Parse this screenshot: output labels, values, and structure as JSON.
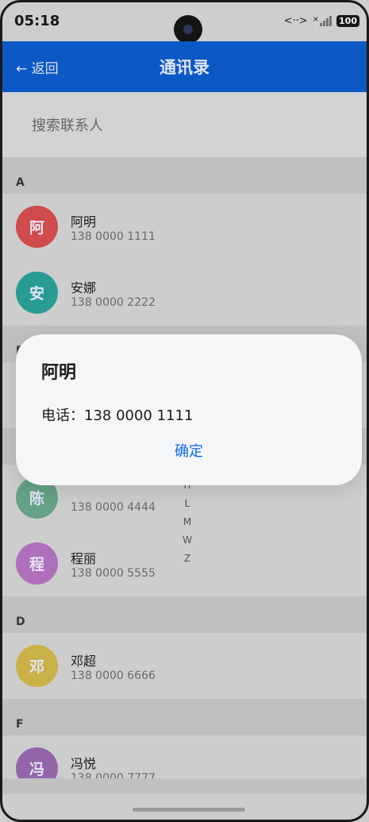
{
  "status_bar": {
    "time": "05:18",
    "network": "<··>",
    "signal_label": "×",
    "battery": "100"
  },
  "app_bar": {
    "back_label": "← 返回",
    "title": "通讯录"
  },
  "search": {
    "placeholder": "搜索联系人"
  },
  "sections": [
    {
      "letter": "A",
      "contacts": [
        {
          "initial": "阿",
          "name": "阿明",
          "phone": "138 0000 1111",
          "color": "#d94f4f"
        },
        {
          "initial": "安",
          "name": "安娜",
          "phone": "138 0000 2222",
          "color": "#2aa39a"
        }
      ]
    },
    {
      "letter": "B",
      "contacts": [
        {
          "initial": "",
          "name": "",
          "phone": "",
          "color": "#d6d6d6"
        }
      ]
    },
    {
      "letter": "",
      "contacts": [
        {
          "initial": "陈",
          "name": "",
          "phone": "138 0000 4444",
          "color": "#6ba98d"
        },
        {
          "initial": "程",
          "name": "程丽",
          "phone": "138 0000 5555",
          "color": "#b774c2"
        }
      ]
    },
    {
      "letter": "D",
      "contacts": [
        {
          "initial": "邓",
          "name": "邓超",
          "phone": "138 0000 6666",
          "color": "#d2b84a"
        }
      ]
    },
    {
      "letter": "F",
      "contacts": [
        {
          "initial": "冯",
          "name": "冯悦",
          "phone": "138 0000 7777",
          "color": "#9b6bb0"
        }
      ]
    }
  ],
  "index_bar": [
    "H",
    "L",
    "M",
    "W",
    "Z"
  ],
  "dialog": {
    "title": "阿明",
    "message": "电话：138 0000 1111",
    "confirm": "确定"
  }
}
